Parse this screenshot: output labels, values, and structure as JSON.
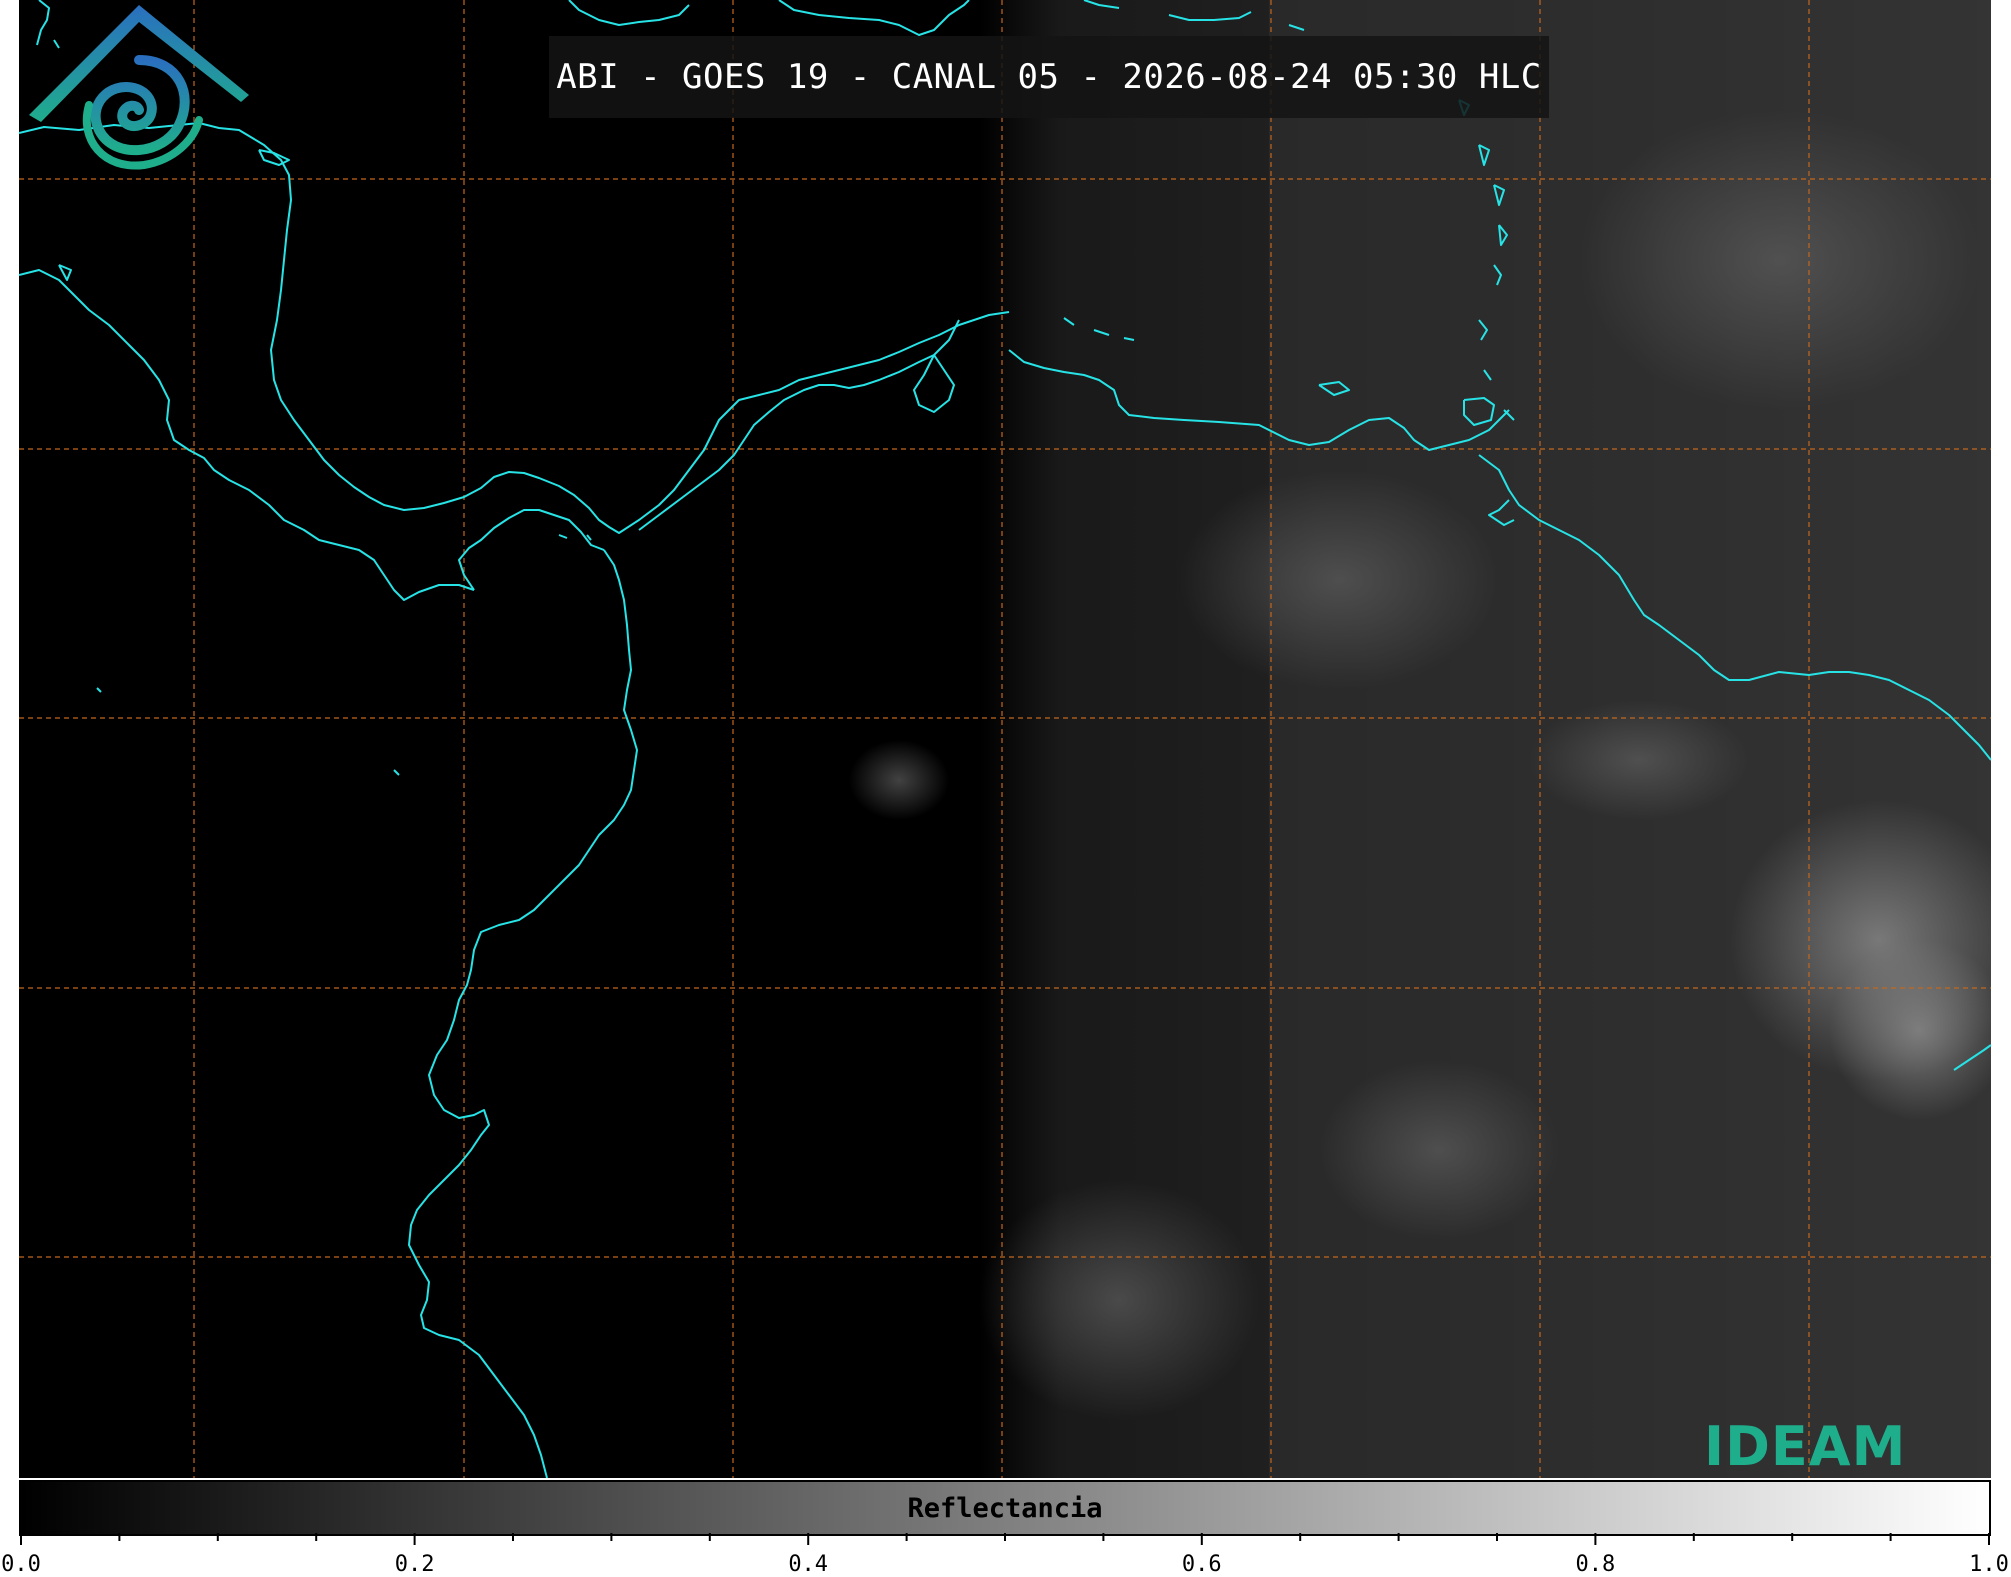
{
  "header": {
    "title": "ABI - GOES 19 - CANAL 05 - 2026-08-24 05:30 HLC"
  },
  "colorbar": {
    "label": "Reflectancia",
    "range": [
      0.0,
      1.0
    ],
    "tick_labels": [
      "0.0",
      "0.2",
      "0.4",
      "0.6",
      "0.8",
      "1.0"
    ],
    "colormap": "grayscale",
    "min_color": "#000000",
    "max_color": "#ffffff"
  },
  "logo": {
    "text": "IDEAM",
    "colors": [
      "#2a6fbf",
      "#1fae8c"
    ]
  },
  "map": {
    "background": "#000000",
    "coastline_color": "#27e3e6",
    "gridline_color": "#c2671e",
    "gridline_style": "dashed"
  }
}
